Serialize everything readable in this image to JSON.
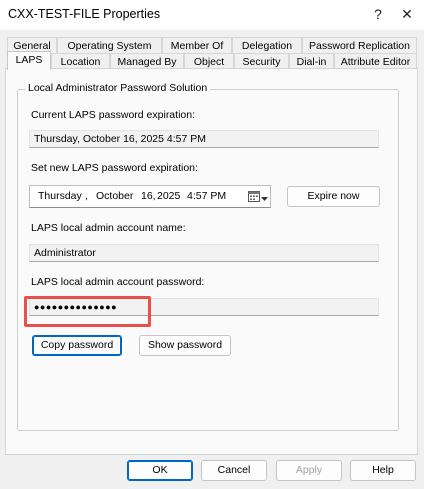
{
  "window": {
    "title": "CXX-TEST-FILE Properties",
    "help_glyph": "?",
    "close_glyph": "✕"
  },
  "tabs": {
    "row1": [
      "General",
      "Operating System",
      "Member Of",
      "Delegation",
      "Password Replication"
    ],
    "row2": [
      "LAPS",
      "Location",
      "Managed By",
      "Object",
      "Security",
      "Dial-in",
      "Attribute Editor"
    ],
    "active": "LAPS"
  },
  "laps": {
    "group_title": "Local Administrator Password Solution",
    "current_expiration_label": "Current LAPS password expiration:",
    "current_expiration_value": "Thursday, October 16, 2025 4:57 PM",
    "set_expiration_label": "Set new LAPS password expiration:",
    "date_picker": {
      "weekday": "Thursday",
      "sep1": ",",
      "month": "October",
      "day": "16,",
      "year": "2025",
      "time": "4:57 PM"
    },
    "expire_now_label": "Expire now",
    "account_name_label": "LAPS local admin account name:",
    "account_name_value": "Administrator",
    "password_label": "LAPS local admin account password:",
    "password_value": "●●●●●●●●●●●●●●",
    "copy_password_label": "Copy password",
    "show_password_label": "Show password"
  },
  "footer": {
    "ok_label": "OK",
    "cancel_label": "Cancel",
    "apply_label": "Apply",
    "help_label": "Help"
  },
  "colors": {
    "highlight_box": "#e8504f",
    "default_button_border": "#0067c0"
  },
  "icons": {
    "calendar": "calendar-icon",
    "dropdown": "chevron-down-icon"
  }
}
